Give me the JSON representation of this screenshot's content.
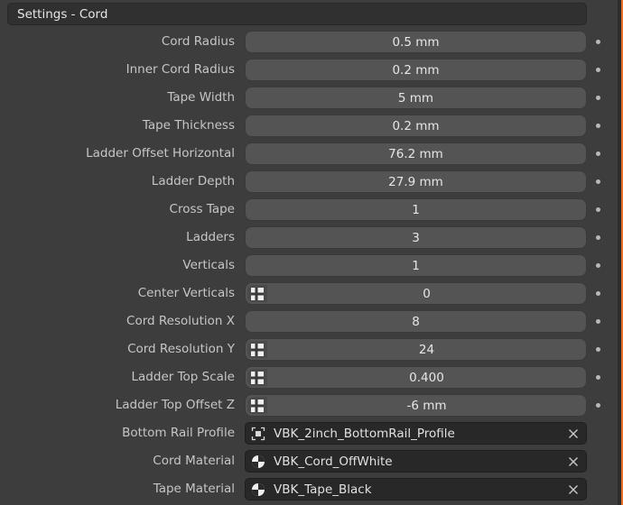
{
  "panel": {
    "title": "Settings - Cord"
  },
  "properties": [
    {
      "label": "Cord Radius",
      "value": "0.5 mm",
      "kind": "number",
      "driven": false
    },
    {
      "label": "Inner Cord Radius",
      "value": "0.2 mm",
      "kind": "number",
      "driven": false
    },
    {
      "label": "Tape Width",
      "value": "5 mm",
      "kind": "number",
      "driven": false
    },
    {
      "label": "Tape Thickness",
      "value": "0.2 mm",
      "kind": "number",
      "driven": false
    },
    {
      "label": "Ladder Offset Horizontal",
      "value": "76.2 mm",
      "kind": "number",
      "driven": false
    },
    {
      "label": "Ladder Depth",
      "value": "27.9 mm",
      "kind": "number",
      "driven": false
    },
    {
      "label": "Cross Tape",
      "value": "1",
      "kind": "number",
      "driven": false
    },
    {
      "label": "Ladders",
      "value": "3",
      "kind": "number",
      "driven": false
    },
    {
      "label": "Verticals",
      "value": "1",
      "kind": "number",
      "driven": false
    },
    {
      "label": "Center Verticals",
      "value": "0",
      "kind": "number",
      "driven": true
    },
    {
      "label": "Cord Resolution X",
      "value": "8",
      "kind": "number",
      "driven": false
    },
    {
      "label": "Cord Resolution Y",
      "value": "24",
      "kind": "number",
      "driven": true
    },
    {
      "label": "Ladder Top Scale",
      "value": "0.400",
      "kind": "number",
      "driven": true
    },
    {
      "label": "Ladder Top Offset Z",
      "value": "-6 mm",
      "kind": "number",
      "driven": true
    },
    {
      "label": "Bottom Rail Profile",
      "value": "VBK_2inch_BottomRail_Profile",
      "kind": "object",
      "icon": "object-icon"
    },
    {
      "label": "Cord Material",
      "value": "VBK_Cord_OffWhite",
      "kind": "material",
      "icon": "material-icon"
    },
    {
      "label": "Tape Material",
      "value": "VBK_Tape_Black",
      "kind": "material",
      "icon": "material-icon"
    }
  ],
  "colors": {
    "accent_edge": "#e76f28",
    "panel_bg": "#3d3d3d",
    "field_bg": "#545454",
    "ref_field_bg": "#282828"
  }
}
